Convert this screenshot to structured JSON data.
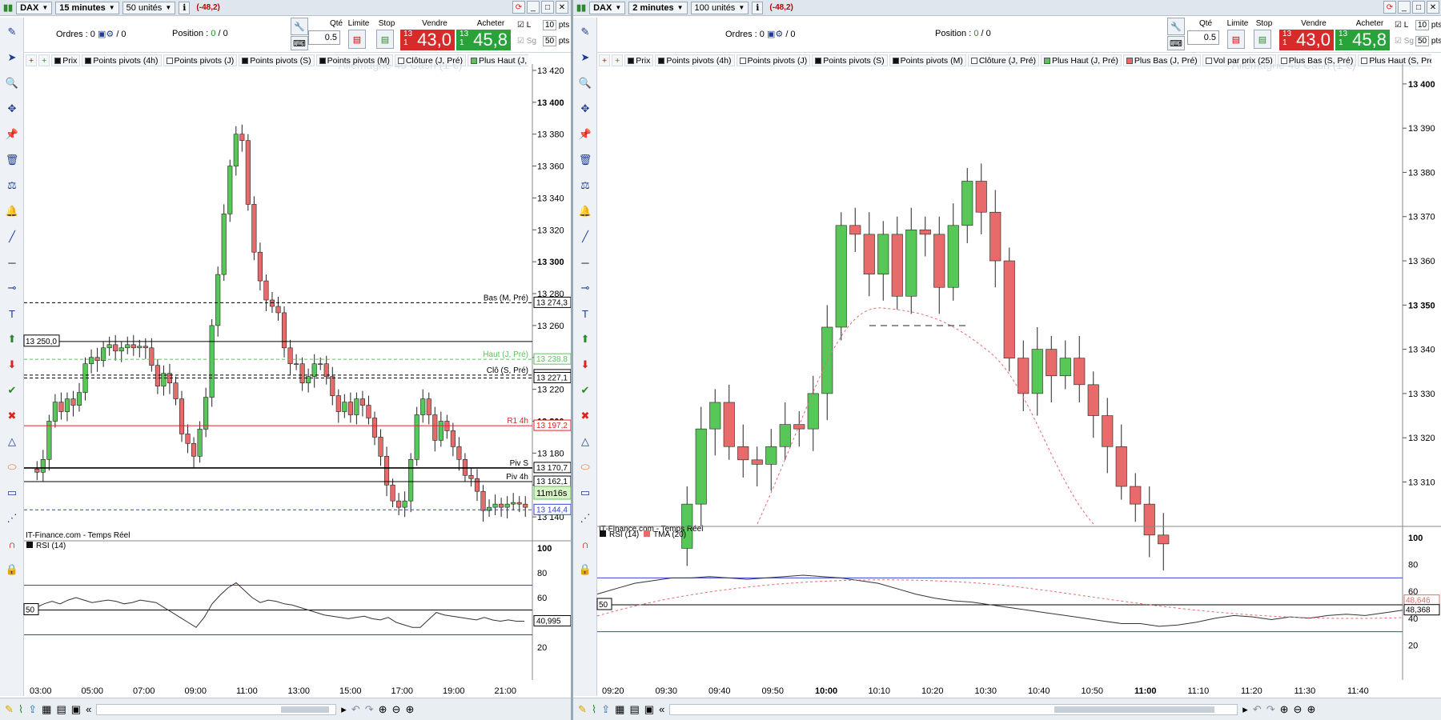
{
  "left": {
    "instrument": "DAX",
    "timeframe": "15 minutes",
    "units": "50 unités",
    "pl": "(-48,2)",
    "orders_label": "Ordres :",
    "orders_val": "0",
    "orders_sep": "/ 0",
    "position_label": "Position :",
    "position_val": "0",
    "position_sep": "/ 0",
    "qty_label": "Qté",
    "qty": "0.5",
    "limit_label": "Limite",
    "stop_label": "Stop",
    "sell_label": "Vendre",
    "buy_label": "Acheter",
    "sell_small": "13 1",
    "sell_big": "43,0",
    "buy_small": "13 1",
    "buy_big": "45,8",
    "chk_l": "L",
    "chk_sg": "Sg",
    "pts1": "10",
    "pts2": "50",
    "pts_label": "pts",
    "indicators": [
      "Prix",
      "Points pivots (4h)",
      "Points pivots (J)",
      "Points pivots (S)",
      "Points pivots (M)",
      "Clôture (J, Pré)",
      "Plus Haut (J, Pré)"
    ],
    "watermark": "Allemagne 40 Cash (1 €)",
    "source": "IT-Finance.com - Temps Réel",
    "rsi_label": "RSI (14)",
    "cursor_label": "13 250,0",
    "rsi_cursor": "50",
    "rsi_value": "40,995",
    "timer": "11m16s",
    "price_ticks": [
      "13 420",
      "13 400",
      "13 380",
      "13 360",
      "13 340",
      "13 320",
      "13 300",
      "13 280",
      "13 260",
      "13 240",
      "13 220",
      "13 200",
      "13 180",
      "13 160",
      "13 140"
    ],
    "rsi_ticks": [
      "100",
      "80",
      "60",
      "40",
      "20"
    ],
    "time_ticks": [
      "03:00",
      "05:00",
      "07:00",
      "09:00",
      "11:00",
      "13:00",
      "15:00",
      "17:00",
      "19:00",
      "21:00"
    ],
    "levels": [
      {
        "name": "Bas (M, Pré)",
        "value": "13 274,3",
        "price": 13274.3,
        "color": "#000000",
        "dash": "4,3"
      },
      {
        "name": "Haut (J, Pré)",
        "value": "13 238,8",
        "price": 13238.8,
        "color": "#5ec15e",
        "dash": "4,3"
      },
      {
        "name": "Clô (S, Pré)",
        "value": "13 228,9",
        "price": 13228.9,
        "color": "#000000",
        "dash": "4,3"
      },
      {
        "name": "",
        "value": "13 227,1",
        "price": 13227.1,
        "color": "#000000",
        "dash": "4,3"
      },
      {
        "name": "R1 4h",
        "value": "13 197,2",
        "price": 13197.2,
        "color": "#e02020",
        "dash": ""
      },
      {
        "name": "Piv S",
        "value": "13 170,7",
        "price": 13170.7,
        "color": "#000000",
        "dash": ""
      },
      {
        "name": "Piv 4h",
        "value": "13 162,1",
        "price": 13162.1,
        "color": "#000000",
        "dash": ""
      },
      {
        "name": "",
        "value": "13 144,4",
        "price": 13144.4,
        "color": "#3344cc",
        "dash": "4,3"
      }
    ]
  },
  "right": {
    "instrument": "DAX",
    "timeframe": "2 minutes",
    "units": "100 unités",
    "pl": "(-48,2)",
    "orders_label": "Ordres :",
    "orders_val": "0",
    "orders_sep": "/ 0",
    "position_label": "Position :",
    "position_val": "0",
    "position_sep": "/ 0",
    "qty_label": "Qté",
    "qty": "0.5",
    "limit_label": "Limite",
    "stop_label": "Stop",
    "sell_label": "Vendre",
    "buy_label": "Acheter",
    "sell_small": "13 1",
    "sell_big": "43,0",
    "buy_small": "13 1",
    "buy_big": "45,8",
    "chk_l": "L",
    "chk_sg": "Sg",
    "pts1": "10",
    "pts2": "50",
    "pts_label": "pts",
    "indicators": [
      "Prix",
      "Points pivots (4h)",
      "Points pivots (J)",
      "Points pivots (S)",
      "Points pivots (M)",
      "Clôture (J, Pré)",
      "Plus Haut (J, Pré)",
      "Plus Bas (J, Pré)",
      "Vol par prix (25)",
      "Plus Bas (S, Pré)",
      "Plus Haut (S, Pré)"
    ],
    "watermark": "Allemagne 40 Cash (1 €)",
    "source": "IT-Finance.com - Temps Réel",
    "rsi_label": "RSI (14)",
    "tma_label": "TMA (20)",
    "rsi_cursor": "50",
    "rsi_value1": "48,646",
    "rsi_value2": "48,368",
    "price_ticks": [
      "13 400",
      "13 390",
      "13 380",
      "13 370",
      "13 360",
      "13 350",
      "13 340",
      "13 330",
      "13 320",
      "13 310"
    ],
    "rsi_ticks": [
      "100",
      "80",
      "60",
      "40",
      "20"
    ],
    "time_ticks": [
      "09:20",
      "09:30",
      "09:40",
      "09:50",
      "10:00",
      "10:10",
      "10:20",
      "10:30",
      "10:40",
      "10:50",
      "11:00",
      "11:10",
      "11:20",
      "11:30",
      "11:40"
    ]
  },
  "colors": {
    "up": "#57c857",
    "down": "#e86a6a",
    "accent": "#1f3a93"
  },
  "icons": [
    "chart-icon",
    "cursor-icon",
    "zoom-icon",
    "crosshair-icon",
    "pin-icon",
    "trash-icon",
    "alert-icon",
    "bell-icon",
    "line-icon",
    "hline-icon",
    "ray-icon",
    "text-icon",
    "arrow-up-icon",
    "arrow-down-icon",
    "check-icon",
    "close-icon",
    "triangle-icon",
    "ellipse-icon",
    "rect-icon",
    "fibo-icon",
    "magnet-icon",
    "lock-icon"
  ]
}
